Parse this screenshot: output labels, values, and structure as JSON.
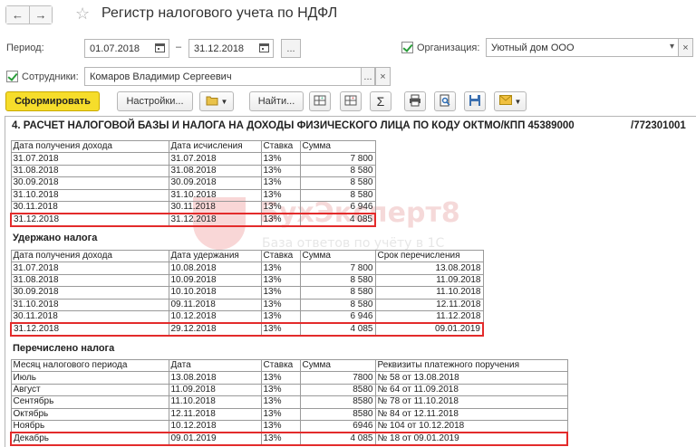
{
  "window": {
    "back_icon": "arrow-left-icon",
    "forward_icon": "arrow-right-icon",
    "favorite_icon": "star-icon",
    "title": "Регистр налогового учета по НДФЛ"
  },
  "filters": {
    "period_label": "Период:",
    "period_from": "01.07.2018",
    "period_dash": "–",
    "period_to": "31.12.2018",
    "period_more": "...",
    "org_label": "Организация:",
    "org_value": "Уютный дом ООО",
    "org_dropdown": "▾",
    "org_clear": "×",
    "employees_label": "Сотрудники:",
    "employees_value": "Комаров Владимир Сергеевич",
    "employees_more": "...",
    "employees_clear": "×"
  },
  "toolbar": {
    "generate": "Сформировать",
    "settings": "Настройки...",
    "find": "Найти...",
    "sum_symbol": "Σ"
  },
  "report": {
    "title": "4. РАСЧЕТ НАЛОГОВОЙ БАЗЫ И НАЛОГА НА ДОХОДЫ ФИЗИЧЕСКОГО ЛИЦА ПО КОДУ ОКТМО/КПП 45389000",
    "title_kpp": "/772301001",
    "income_table": {
      "headers": [
        "Дата получения дохода",
        "Дата исчисления",
        "Ставка",
        "Сумма"
      ],
      "rows": [
        [
          "31.07.2018",
          "31.07.2018",
          "13%",
          "7 800"
        ],
        [
          "31.08.2018",
          "31.08.2018",
          "13%",
          "8 580"
        ],
        [
          "30.09.2018",
          "30.09.2018",
          "13%",
          "8 580"
        ],
        [
          "31.10.2018",
          "31.10.2018",
          "13%",
          "8 580"
        ],
        [
          "30.11.2018",
          "30.11.2018",
          "13%",
          "6 946"
        ],
        [
          "31.12.2018",
          "31.12.2018",
          "13%",
          "4 085"
        ]
      ]
    },
    "withheld_title": "Удержано налога",
    "withheld_table": {
      "headers": [
        "Дата получения дохода",
        "Дата удержания",
        "Ставка",
        "Сумма",
        "Срок перечисления"
      ],
      "rows": [
        [
          "31.07.2018",
          "10.08.2018",
          "13%",
          "7 800",
          "13.08.2018"
        ],
        [
          "31.08.2018",
          "10.09.2018",
          "13%",
          "8 580",
          "11.09.2018"
        ],
        [
          "30.09.2018",
          "10.10.2018",
          "13%",
          "8 580",
          "11.10.2018"
        ],
        [
          "31.10.2018",
          "09.11.2018",
          "13%",
          "8 580",
          "12.11.2018"
        ],
        [
          "30.11.2018",
          "10.12.2018",
          "13%",
          "6 946",
          "11.12.2018"
        ],
        [
          "31.12.2018",
          "29.12.2018",
          "13%",
          "4 085",
          "09.01.2019"
        ]
      ]
    },
    "transferred_title": "Перечислено налога",
    "transferred_table": {
      "headers": [
        "Месяц налогового периода",
        "Дата",
        "Ставка",
        "Сумма",
        "Реквизиты платежного поручения"
      ],
      "rows": [
        [
          "Июль",
          "13.08.2018",
          "13%",
          "7800",
          "№ 58 от 13.08.2018"
        ],
        [
          "Август",
          "11.09.2018",
          "13%",
          "8580",
          "№ 64 от 11.09.2018"
        ],
        [
          "Сентябрь",
          "11.10.2018",
          "13%",
          "8580",
          "№ 78 от 11.10.2018"
        ],
        [
          "Октябрь",
          "12.11.2018",
          "13%",
          "8580",
          "№ 84 от 12.11.2018"
        ],
        [
          "Ноябрь",
          "10.12.2018",
          "13%",
          "6946",
          "№ 104 от 10.12.2018"
        ],
        [
          "Декабрь",
          "09.01.2019",
          "13%",
          "4 085",
          "№ 18 от 09.01.2019"
        ]
      ]
    },
    "highlight_color": "#e32b2b"
  },
  "watermark": {
    "brand": "БухЭксперт8",
    "tagline": "База ответов по учёту в 1С"
  },
  "colors": {
    "accent_button": "#f6dd2b",
    "checkbox_mark": "#2a9d3a"
  }
}
